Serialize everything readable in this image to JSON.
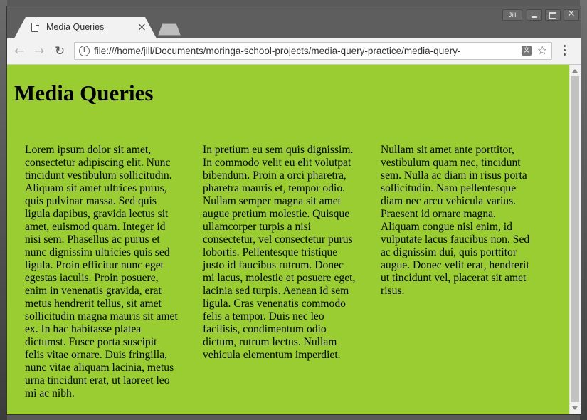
{
  "browser": {
    "tab_title": "Media Queries",
    "tab_close": "×",
    "profile_name": "Jill",
    "url": "file:///home/jill/Documents/moringa-school-projects/media-query-practice/media-query-"
  },
  "page": {
    "background_color": "#9acd32",
    "heading": "Media Queries",
    "columns": [
      "Lorem ipsum dolor sit amet, consectetur adipiscing elit. Nunc tincidunt vestibulum sollicitudin. Aliquam sit amet ultrices purus, quis pulvinar massa. Sed quis ligula dapibus, gravida lectus sit amet, euismod quam. Integer id nisi sem. Phasellus ac purus et nunc dignissim ultricies quis sed ligula. Proin efficitur nunc eget egestas iaculis. Proin posuere, enim in venenatis gravida, erat metus hendrerit tellus, sit amet sollicitudin magna mauris sit amet ex. In hac habitasse platea dictumst. Fusce porta suscipit felis vitae ornare. Duis fringilla, nunc vitae aliquam lacinia, metus urna tincidunt erat, ut laoreet leo mi ac nibh.",
      "In pretium eu sem quis dignissim. In commodo velit eu elit volutpat bibendum. Proin a orci pharetra, pharetra mauris et, tempor odio. Nullam semper magna sit amet augue pretium molestie. Quisque ullamcorper turpis a nisi consectetur, vel consectetur purus lobortis. Pellentesque tristique justo id faucibus rutrum. Donec mi lacus, molestie et posuere eget, lacinia sed turpis. Aenean id sem ligula. Cras venenatis commodo felis a tempor. Duis nec leo facilisis, condimentum odio dictum, rutrum lectus. Nullam vehicula elementum imperdiet.",
      "Nullam sit amet ante porttitor, vestibulum quam nec, tincidunt sem. Nulla ac diam in risus porta sollicitudin. Nam pellentesque diam nec arcu vehicula varius. Praesent id ornare magna. Aliquam congue nisl enim, id vulputate lacus faucibus non. Sed ac dignissim dui, quis porttitor augue. Donec velit erat, hendrerit ut tincidunt vel, placerat sit amet risus."
    ]
  },
  "icons": {
    "tab": "document-icon",
    "back": "back-arrow-icon",
    "forward": "forward-arrow-icon",
    "reload": "reload-icon",
    "info": "info-icon",
    "translate": "translate-icon",
    "bookmark": "star-icon",
    "menu": "kebab-menu-icon"
  }
}
